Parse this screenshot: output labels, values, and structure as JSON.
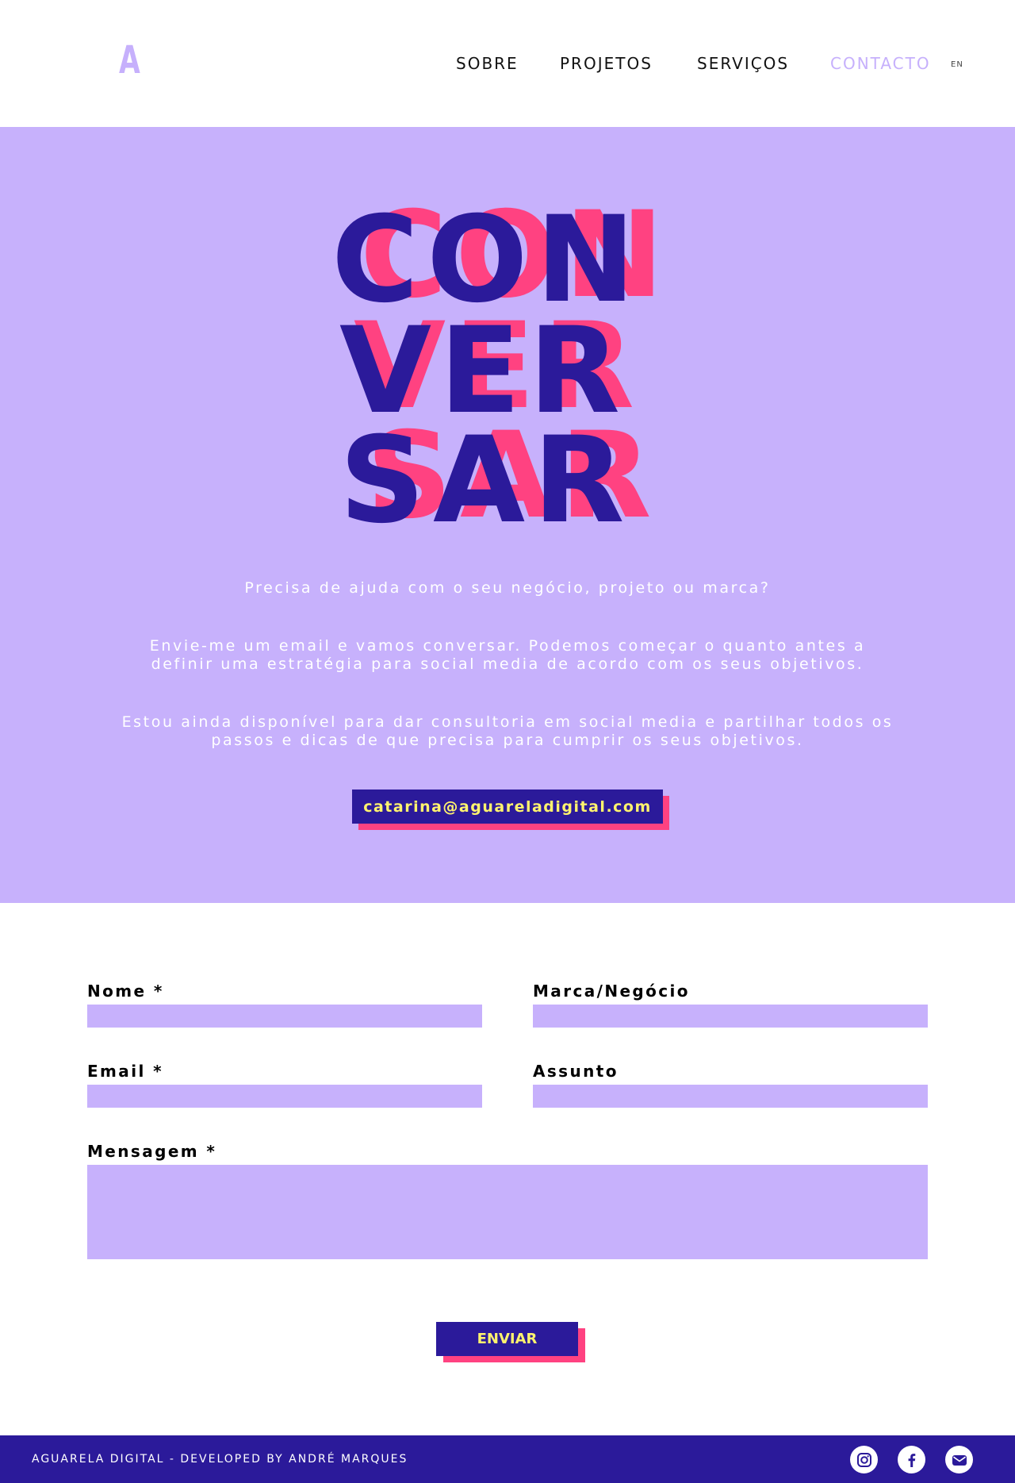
{
  "header": {
    "logo": "A",
    "nav": [
      "SOBRE",
      "PROJETOS",
      "SERVIÇOS",
      "CONTACTO"
    ],
    "lang": "EN",
    "active_nav": "CONTACTO"
  },
  "hero": {
    "title_lines": [
      "CON",
      "VER",
      "SAR"
    ],
    "paragraph_1": "Precisa de ajuda com o seu negócio, projeto ou marca?",
    "paragraph_2": "Envie-me um email e vamos conversar. Podemos começar o quanto antes a definir uma estratégia para social media de acordo com os seus objetivos.",
    "paragraph_3": "Estou ainda disponível para dar consultoria em social media e partilhar todos os passos e dicas de que precisa para cumprir os seus objetivos.",
    "email": "catarina@aguareladigital.com"
  },
  "form": {
    "name_label": "Nome *",
    "brand_label": "Marca/Negócio",
    "email_label": "Email *",
    "subject_label": "Assunto",
    "message_label": "Mensagem *",
    "name_value": "",
    "brand_value": "",
    "email_value": "",
    "subject_value": "",
    "message_value": "",
    "submit_label": "ENVIAR"
  },
  "footer": {
    "credit": "AGUARELA DIGITAL - DEVELOPED BY ANDRÉ MARQUES",
    "social_icons": [
      "instagram-icon",
      "facebook-icon",
      "mail-icon"
    ]
  },
  "colors": {
    "lavender": "#c7b1fc",
    "navy": "#2b1a9a",
    "pink": "#ff4281",
    "yellow": "#fff36e"
  }
}
